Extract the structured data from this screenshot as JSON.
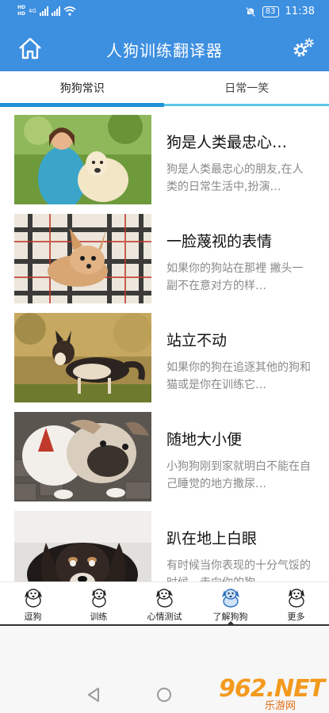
{
  "status_bar": {
    "left_badges": [
      "HD",
      "HD"
    ],
    "network": "4G",
    "battery": "83",
    "time": "11:38"
  },
  "app_bar": {
    "title": "人狗训练翻译器",
    "home_icon": "home-icon",
    "settings_icon": "gear-icon"
  },
  "tabs": [
    {
      "label": "狗狗常识",
      "active": true
    },
    {
      "label": "日常一笑",
      "active": false
    }
  ],
  "articles": [
    {
      "title": "狗是人类最忠心…",
      "desc": "狗是人类最忠心的朋友,在人类的日常生活中,扮演…",
      "image": "woman-with-golden-retriever"
    },
    {
      "title": "一脸蔑视的表情",
      "desc": "如果你的狗站在那裡 撇头一副不在意对方的样…",
      "image": "chihuahua-on-plaid-blanket"
    },
    {
      "title": "站立不动",
      "desc": "如果你的狗在追逐其他的狗和猫或是你在训练它…",
      "image": "sheltie-in-autumn-grass"
    },
    {
      "title": "随地大小便",
      "desc": "小狗狗刚到家就明白不能在自己睡觉的地方撒尿…",
      "image": "bulldog-on-pavement"
    },
    {
      "title": "趴在地上白眼",
      "desc": "有时候当你表现的十分气馁的时候，走向你的狗",
      "image": "dog-lying-down"
    }
  ],
  "bottom_nav": [
    {
      "label": "逗狗",
      "icon": "dog-icon",
      "active": false
    },
    {
      "label": "训练",
      "icon": "dog-icon",
      "active": false
    },
    {
      "label": "心情测试",
      "icon": "dog-icon",
      "active": false
    },
    {
      "label": "了解狗狗",
      "icon": "dog-icon",
      "active": true
    },
    {
      "label": "更多",
      "icon": "dog-icon",
      "active": false
    }
  ],
  "watermark": {
    "text": "962.NET",
    "sub": "乐游网"
  },
  "colors": {
    "primary": "#3d8fe0",
    "tab_active": "#1e90d6",
    "tab_line": "#5bc7e8"
  }
}
